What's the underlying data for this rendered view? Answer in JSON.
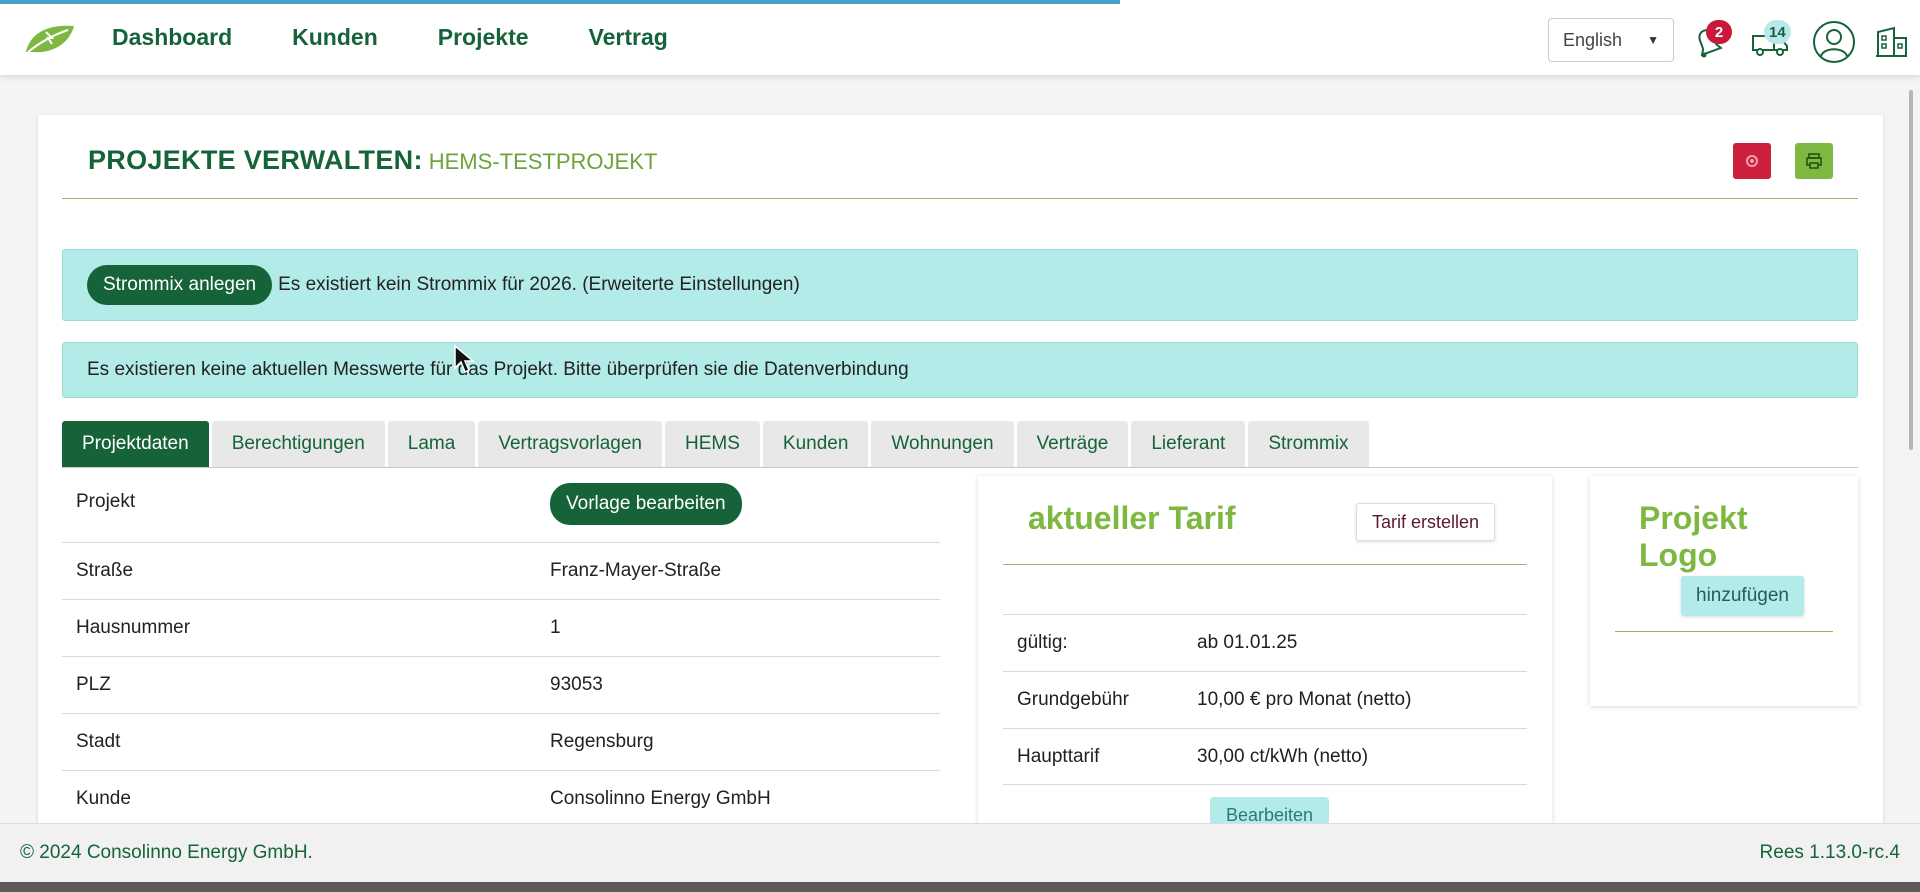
{
  "header": {
    "nav": [
      "Dashboard",
      "Kunden",
      "Projekte",
      "Vertrag"
    ],
    "language": "English",
    "notifications_count": "2",
    "messages_count": "14",
    "icons": [
      "logo-leaf-icon",
      "bell-icon",
      "truck-icon",
      "user-avatar-icon",
      "building-icon"
    ]
  },
  "page": {
    "title": "PROJEKTE VERWALTEN:",
    "subtitle": "HEMS-TESTPROJEKT",
    "settings_icon": "gear-icon",
    "print_icon": "printer-icon"
  },
  "alerts": {
    "strommix_button": "Strommix anlegen",
    "strommix_text": "Es existiert kein Strommix für 2026. (Erweiterte Einstellungen)",
    "messwerte_text": "Es existieren keine aktuellen Messwerte für das Projekt. Bitte überprüfen sie die Datenverbindung"
  },
  "tabs": [
    "Projektdaten",
    "Berechtigungen",
    "Lama",
    "Vertragsvorlagen",
    "HEMS",
    "Kunden",
    "Wohnungen",
    "Verträge",
    "Lieferant",
    "Strommix"
  ],
  "active_tab": "Projektdaten",
  "project": {
    "rows": [
      {
        "label": "Projekt",
        "button": "Vorlage bearbeiten"
      },
      {
        "label": "Straße",
        "value": "Franz-Mayer-Straße"
      },
      {
        "label": "Hausnummer",
        "value": "1"
      },
      {
        "label": "PLZ",
        "value": "93053"
      },
      {
        "label": "Stadt",
        "value": "Regensburg"
      },
      {
        "label": "Kunde",
        "value": "Consolinno Energy GmbH"
      }
    ]
  },
  "tarif": {
    "title": "aktueller Tarif",
    "create_button": "Tarif erstellen",
    "rows": [
      {
        "label": "gültig:",
        "value": "ab 01.01.25"
      },
      {
        "label": "Grundgebühr",
        "value": "10,00 € pro Monat (netto)"
      },
      {
        "label": "Haupttarif",
        "value": "30,00 ct/kWh (netto)"
      }
    ],
    "edit_button": "Bearbeiten"
  },
  "logo_panel": {
    "title": "Projekt Logo",
    "add_button": "hinzufügen"
  },
  "footer": {
    "copyright": "© 2024 Consolinno Energy GmbH.",
    "version": "Rees 1.13.0-rc.4"
  },
  "colors": {
    "brand_green": "#16633a",
    "accent_green": "#7fb841",
    "alert_bg": "#b3ebe8",
    "danger": "#cc1f3e"
  }
}
